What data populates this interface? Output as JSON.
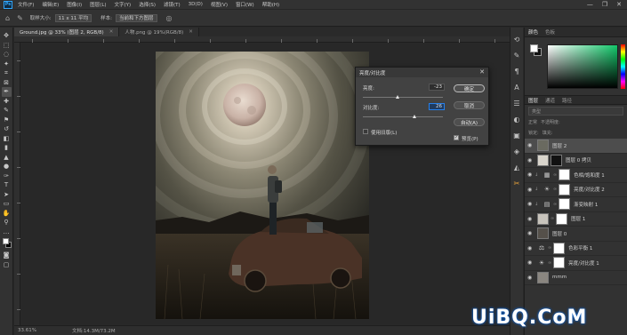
{
  "app": {
    "logo": "Ps"
  },
  "menu": [
    "文件(F)",
    "编辑(E)",
    "图像(I)",
    "图层(L)",
    "文字(Y)",
    "选择(S)",
    "滤镜(T)",
    "3D(D)",
    "视图(V)",
    "窗口(W)",
    "帮助(H)"
  ],
  "window_controls": {
    "minimize": "—",
    "restore": "❐",
    "close": "✕"
  },
  "options": {
    "sample_size_label": "取样大小:",
    "sample_size_value": "11 x 11 平均",
    "sample_label": "样本:",
    "sample_value": "当前和下方图层"
  },
  "tabs": [
    {
      "label": "Ground.jpg @ 33% (图层 2, RGB/8)",
      "active": true
    },
    {
      "label": "人物.png @ 19%(RGB/8)",
      "active": false
    }
  ],
  "statusbar": {
    "zoom": "33.61%",
    "doc": "文档:14.3M/73.2M"
  },
  "color_panel": {
    "tabs": [
      "颜色",
      "色板"
    ],
    "accent": "#12c86a"
  },
  "layers_panel": {
    "tabs": [
      "图层",
      "通道",
      "路径"
    ],
    "filter_label": "类型",
    "mode_label": "正常",
    "opacity_label": "不透明度:",
    "lock_label": "锁定:",
    "fill_label": "填充:",
    "layers": [
      {
        "name": "图层 2",
        "selected": true,
        "kind": "pixel"
      },
      {
        "name": "图层 0 拷贝",
        "selected": false,
        "kind": "pixel-mask"
      },
      {
        "name": "色相/饱和度 1",
        "selected": false,
        "kind": "adjust",
        "icon": "▦"
      },
      {
        "name": "亮度/对比度 2",
        "selected": false,
        "kind": "adjust",
        "icon": "☀"
      },
      {
        "name": "渐变映射 1",
        "selected": false,
        "kind": "adjust",
        "icon": "▤"
      },
      {
        "name": "图层 1",
        "selected": false,
        "kind": "pixel-mask"
      },
      {
        "name": "图层 0",
        "selected": false,
        "kind": "pixel"
      },
      {
        "name": "色彩平衡 1",
        "selected": false,
        "kind": "adjust",
        "icon": "⚖"
      },
      {
        "name": "亮度/对比度 1",
        "selected": false,
        "kind": "adjust",
        "icon": "☀"
      },
      {
        "name": "mmm",
        "selected": false,
        "kind": "pixel"
      }
    ]
  },
  "dialog": {
    "title": "亮度/对比度",
    "brightness_label": "亮度:",
    "brightness_value": "-23",
    "contrast_label": "对比度:",
    "contrast_value": "26",
    "ok": "确定",
    "cancel": "取消",
    "auto": "自动(A)",
    "legacy": "使用旧版(L)",
    "preview": "预览(P)",
    "preview_checked": true
  },
  "watermark": "UiBQ.CoM"
}
